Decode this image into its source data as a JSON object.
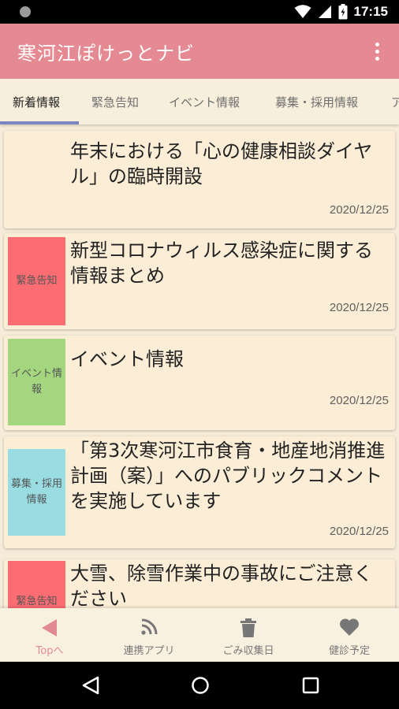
{
  "status_bar": {
    "time": "17:15",
    "icons": [
      "notification-dot-icon",
      "wifi-icon",
      "signal-icon",
      "battery-charging-icon"
    ]
  },
  "app_bar": {
    "title": "寒河江ぽけっとナビ",
    "menu_icon": "overflow-menu-icon"
  },
  "tabs": [
    {
      "label": "新着情報",
      "active": true
    },
    {
      "label": "緊急告知",
      "active": false
    },
    {
      "label": "イベント情報",
      "active": false
    },
    {
      "label": "募集・採用情報",
      "active": false
    },
    {
      "label": "ア",
      "active": false
    }
  ],
  "news": [
    {
      "badge": "",
      "badge_color": "",
      "title": "年末における「心の健康相談ダイヤル」の臨時開設",
      "date": "2020/12/25"
    },
    {
      "badge": "緊急告知",
      "badge_color": "#fb6d73",
      "title": "新型コロナウィルス感染症に関する情報まとめ",
      "date": "2020/12/25"
    },
    {
      "badge": "イベント情報",
      "badge_color": "#a3d67f",
      "title": "イベント情報",
      "date": "2020/12/25"
    },
    {
      "badge": "募集・採用情報",
      "badge_color": "#99dde3",
      "title": "「第3次寒河江市食育・地産地消推進計画（案）」へのパブリックコメントを実施しています",
      "date": "2020/12/25"
    },
    {
      "badge": "緊急告知",
      "badge_color": "#fb6d73",
      "title": "大雪、除雪作業中の事故にご注意ください",
      "date": ""
    }
  ],
  "bottom_nav": [
    {
      "label": "Topへ",
      "icon": "back-arrow-icon",
      "active": true
    },
    {
      "label": "連携アプリ",
      "icon": "rss-icon",
      "active": false
    },
    {
      "label": "ごみ収集日",
      "icon": "trash-icon",
      "active": false
    },
    {
      "label": "健診予定",
      "icon": "heart-icon",
      "active": false
    }
  ],
  "colors": {
    "app_bar": "#e58a92",
    "background": "#f6ecd9",
    "card": "#fbedd6",
    "tab_indicator": "#7c84c2",
    "nav_active": "#e28a93"
  }
}
